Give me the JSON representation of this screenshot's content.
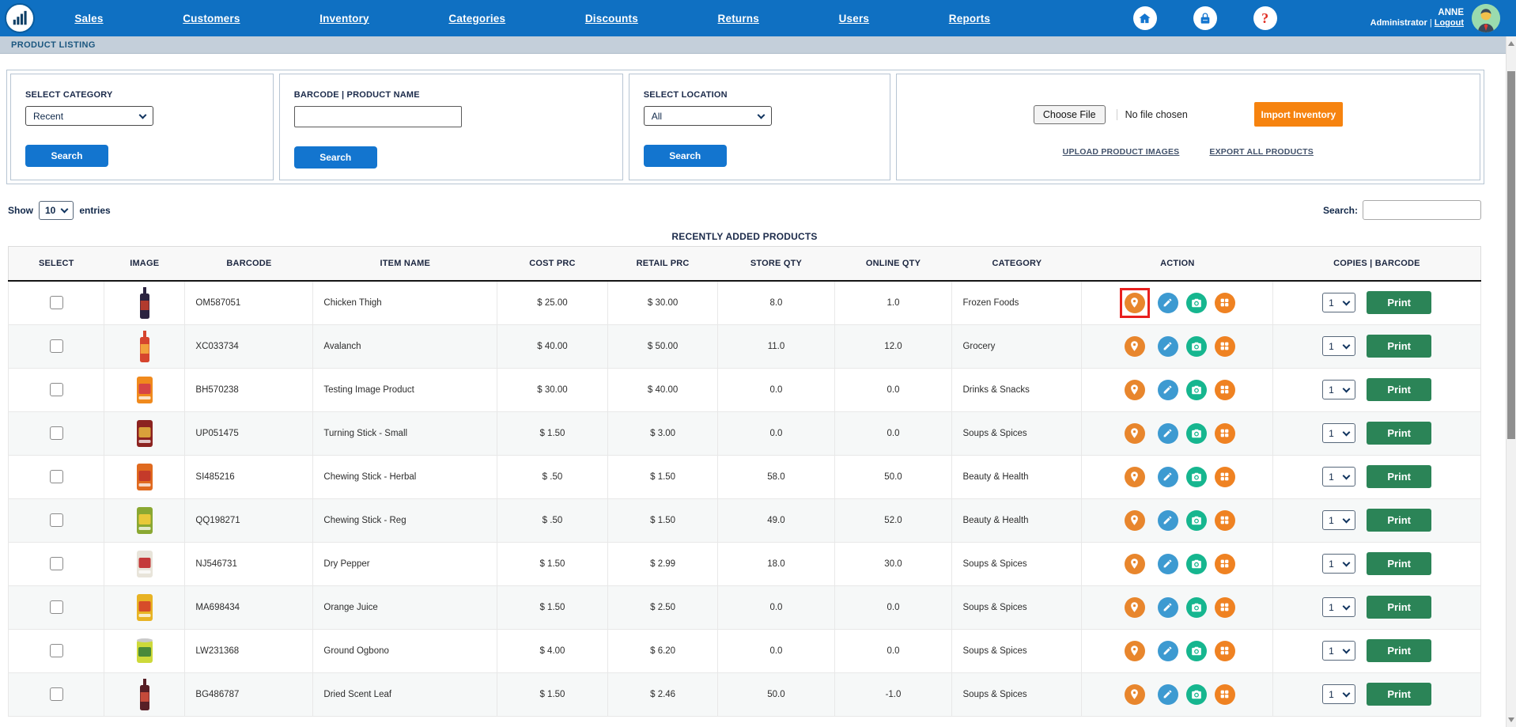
{
  "colors": {
    "nav_blue": "#0f70c2",
    "btn_blue": "#1375cf",
    "navy": "#1b2a4a",
    "bread_bg": "#c4cfda",
    "bread_text": "#1a567f",
    "orange": "#f6830f",
    "green": "#2b8457",
    "icon_orange": "#e8862d",
    "icon_blue": "#3d9ad1",
    "icon_green": "#16b68f",
    "icon_grid": "#ef8222",
    "hl_red": "#e8201f"
  },
  "nav": {
    "menu_items": [
      "Sales",
      "Customers",
      "Inventory",
      "Categories",
      "Discounts",
      "Returns",
      "Users",
      "Reports"
    ],
    "icon_names": [
      "home-icon",
      "lock-icon",
      "help-icon"
    ],
    "help_glyph": "?",
    "user": {
      "name": "ANNE",
      "role": "Administrator",
      "separator": "|",
      "logout_label": "Logout"
    }
  },
  "breadcrumb": {
    "title": "PRODUCT LISTING"
  },
  "filters": {
    "category": {
      "label": "SELECT CATEGORY",
      "selected": "Recent",
      "search_label": "Search"
    },
    "barcode": {
      "label": "BARCODE | PRODUCT NAME",
      "value": "",
      "search_label": "Search"
    },
    "location": {
      "label": "SELECT LOCATION",
      "selected": "All",
      "search_label": "Search"
    },
    "import": {
      "choose_file_label": "Choose File",
      "file_status": "No file chosen",
      "import_label": "Import Inventory",
      "upload_link": "UPLOAD PRODUCT IMAGES",
      "export_link": "EXPORT ALL PRODUCTS"
    }
  },
  "table_controls": {
    "show_label": "Show",
    "page_size": "10",
    "entries_label": "entries",
    "search_label": "Search:",
    "search_value": ""
  },
  "table": {
    "title": "RECENTLY ADDED PRODUCTS",
    "columns": [
      "SELECT",
      "IMAGE",
      "BARCODE",
      "ITEM NAME",
      "COST PRC",
      "RETAIL PRC",
      "STORE QTY",
      "ONLINE QTY",
      "CATEGORY",
      "ACTION",
      "COPIES  |  BARCODE"
    ],
    "action_icon_names": [
      "location-icon",
      "edit-icon",
      "camera-icon",
      "barcode-grid-icon"
    ],
    "rows": [
      {
        "barcode": "OM587051",
        "item_name": "Chicken Thigh",
        "cost": "$ 25.00",
        "retail": "$ 30.00",
        "store_qty": "8.0",
        "online_qty": "1.0",
        "category": "Frozen Foods",
        "copies": "1",
        "print_label": "Print",
        "highlight_location": true,
        "thumb": {
          "shape": "bottle",
          "c1": "#2b2340",
          "c2": "#b23b2e"
        }
      },
      {
        "barcode": "XC033734",
        "item_name": "Avalanch",
        "cost": "$ 40.00",
        "retail": "$ 50.00",
        "store_qty": "11.0",
        "online_qty": "12.0",
        "category": "Grocery",
        "copies": "1",
        "print_label": "Print",
        "highlight_location": false,
        "thumb": {
          "shape": "bottle",
          "c1": "#d6452e",
          "c2": "#f2a13c"
        }
      },
      {
        "barcode": "BH570238",
        "item_name": "Testing Image Product",
        "cost": "$ 30.00",
        "retail": "$ 40.00",
        "store_qty": "0.0",
        "online_qty": "0.0",
        "category": "Drinks & Snacks",
        "copies": "1",
        "print_label": "Print",
        "highlight_location": false,
        "thumb": {
          "shape": "packet",
          "c1": "#f08a1d",
          "c2": "#d64545"
        }
      },
      {
        "barcode": "UP051475",
        "item_name": "Turning Stick - Small",
        "cost": "$ 1.50",
        "retail": "$ 3.00",
        "store_qty": "0.0",
        "online_qty": "0.0",
        "category": "Soups & Spices",
        "copies": "1",
        "print_label": "Print",
        "highlight_location": false,
        "thumb": {
          "shape": "packet",
          "c1": "#8c2320",
          "c2": "#d9a13a"
        }
      },
      {
        "barcode": "SI485216",
        "item_name": "Chewing Stick - Herbal",
        "cost": "$ .50",
        "retail": "$ 1.50",
        "store_qty": "58.0",
        "online_qty": "50.0",
        "category": "Beauty & Health",
        "copies": "1",
        "print_label": "Print",
        "highlight_location": false,
        "thumb": {
          "shape": "packet",
          "c1": "#e06a1f",
          "c2": "#c43a2a"
        }
      },
      {
        "barcode": "QQ198271",
        "item_name": "Chewing Stick - Reg",
        "cost": "$ .50",
        "retail": "$ 1.50",
        "store_qty": "49.0",
        "online_qty": "52.0",
        "category": "Beauty & Health",
        "copies": "1",
        "print_label": "Print",
        "highlight_location": false,
        "thumb": {
          "shape": "packet",
          "c1": "#8aa832",
          "c2": "#e8c93a"
        }
      },
      {
        "barcode": "NJ546731",
        "item_name": "Dry Pepper",
        "cost": "$ 1.50",
        "retail": "$ 2.99",
        "store_qty": "18.0",
        "online_qty": "30.0",
        "category": "Soups & Spices",
        "copies": "1",
        "print_label": "Print",
        "highlight_location": false,
        "thumb": {
          "shape": "packet",
          "c1": "#e8e4da",
          "c2": "#c43a3a"
        }
      },
      {
        "barcode": "MA698434",
        "item_name": "Orange Juice",
        "cost": "$ 1.50",
        "retail": "$ 2.50",
        "store_qty": "0.0",
        "online_qty": "0.0",
        "category": "Soups & Spices",
        "copies": "1",
        "print_label": "Print",
        "highlight_location": false,
        "thumb": {
          "shape": "packet",
          "c1": "#e8b324",
          "c2": "#d64c2a"
        }
      },
      {
        "barcode": "LW231368",
        "item_name": "Ground Ogbono",
        "cost": "$ 4.00",
        "retail": "$ 6.20",
        "store_qty": "0.0",
        "online_qty": "0.0",
        "category": "Soups & Spices",
        "copies": "1",
        "print_label": "Print",
        "highlight_location": false,
        "thumb": {
          "shape": "can",
          "c1": "#cdd93a",
          "c2": "#4a8a3a"
        }
      },
      {
        "barcode": "BG486787",
        "item_name": "Dried Scent Leaf",
        "cost": "$ 1.50",
        "retail": "$ 2.46",
        "store_qty": "50.0",
        "online_qty": "-1.0",
        "category": "Soups & Spices",
        "copies": "1",
        "print_label": "Print",
        "highlight_location": false,
        "thumb": {
          "shape": "bottle",
          "c1": "#571f26",
          "c2": "#c44a3a"
        }
      }
    ]
  }
}
